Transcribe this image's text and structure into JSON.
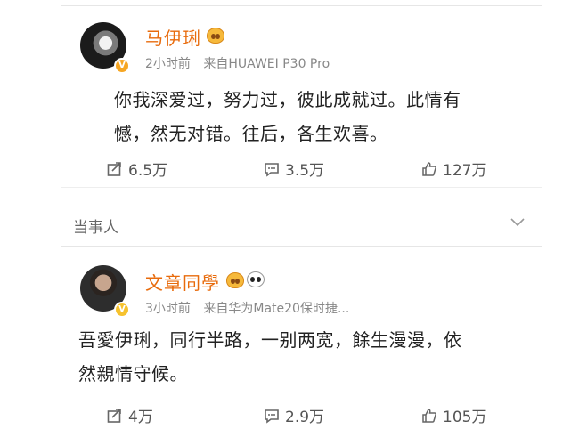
{
  "post1": {
    "author": "马伊琍",
    "time": "2小时前",
    "source": "来自HUAWEI P30 Pro",
    "text_line1": "你我深爱过，努力过，彼此成就过。此情有",
    "text_line2": "憾，然无对错。往后，各生欢喜。",
    "reposts": "6.5万",
    "comments": "3.5万",
    "likes": "127万"
  },
  "section_label": "当事人",
  "post2": {
    "author": "文章同學",
    "time": "3小时前",
    "source": "来自华为Mate20保时捷...",
    "text_line1": "吾愛伊琍，同行半路，一别两宽，餘生漫漫，依",
    "text_line2": "然親情守候。",
    "reposts": "4万",
    "comments": "2.9万",
    "likes": "105万"
  },
  "colors": {
    "name": "#e86b0c",
    "meta": "#888888",
    "badge": "#f6a623"
  },
  "icons": [
    "share-icon",
    "comment-icon",
    "like-icon",
    "chevron-down-icon",
    "verified-badge-icon"
  ]
}
